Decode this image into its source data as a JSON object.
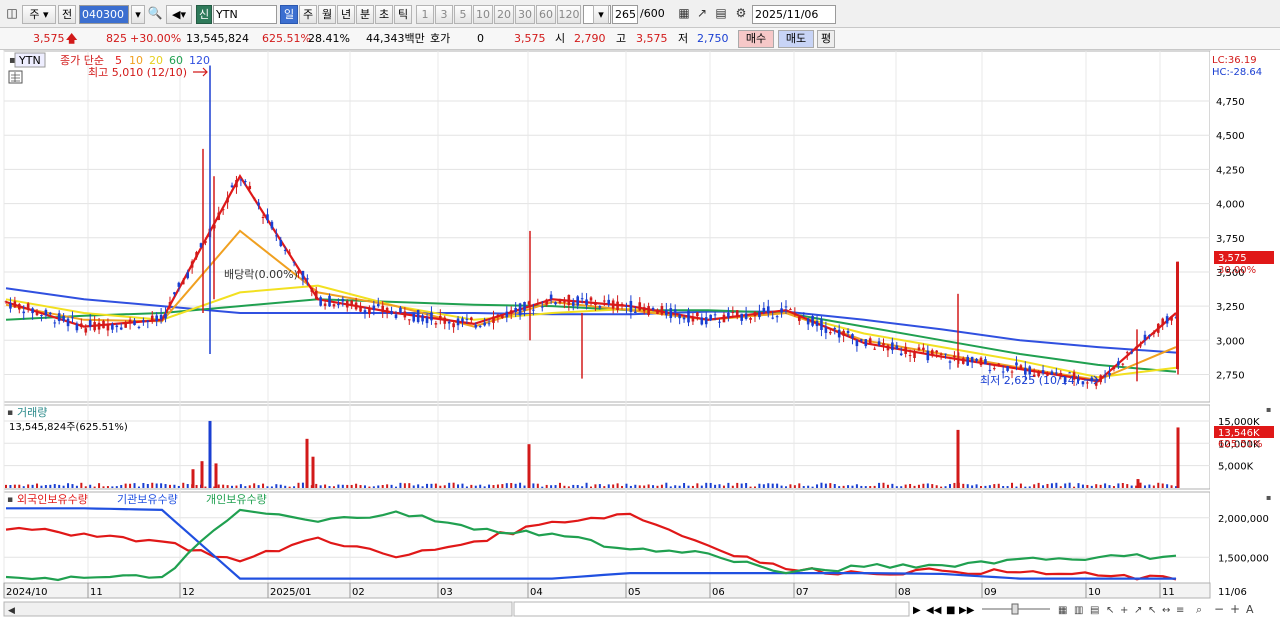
{
  "toolbar": {
    "period_label": "주",
    "prev_label": "전",
    "stock_code": "040300",
    "stock_badge": "신",
    "stock_name": "YTN",
    "period_tabs": [
      "일",
      "주",
      "월",
      "년",
      "분",
      "초",
      "틱"
    ],
    "interval_tabs": [
      "1",
      "3",
      "5",
      "10",
      "20",
      "30",
      "60",
      "120"
    ],
    "count": "265",
    "count_total": "/600",
    "date": "2025/11/06"
  },
  "quote": {
    "price": "3,575",
    "change": "825",
    "change_pct": "+30.00%",
    "volume": "13,545,824",
    "volume_pct": "625.51%",
    "turnover": "28.41%",
    "amount": "44,343백만",
    "hoga_label": "호가",
    "hoga_value": "0",
    "hoga_price": "3,575",
    "open_label": "시",
    "open": "2,790",
    "high_label": "고",
    "high": "3,575",
    "low_label": "저",
    "low": "2,750",
    "buy_label": "매수",
    "sell_label": "매도",
    "eval_label": "평"
  },
  "price_pane": {
    "symbol": "YTN",
    "legend_prefix": "종가 단순",
    "ma_periods": [
      "5",
      "10",
      "20",
      "60",
      "120"
    ],
    "high_annotation": "최고 5,010 (12/10)",
    "low_annotation": "최저 2,625 (10/14)",
    "dividend_annotation": "배당락(0.00%)",
    "lc": "LC:36.19",
    "hc": "HC:-28.64",
    "last_price_tag": "3,575",
    "last_pct_tag": "30.00%",
    "y_ticks": [
      "4,750",
      "4,500",
      "4,250",
      "4,000",
      "3,750",
      "3,500",
      "3,250",
      "3,000",
      "2,750"
    ]
  },
  "volume_pane": {
    "title": "거래량",
    "subtitle": "13,545,824주(625.51%)",
    "y_ticks": [
      "15,000K",
      "10,000K",
      "5,000K"
    ],
    "last_tag": "13,546K",
    "last_pct_tag": "625.51%"
  },
  "holdings_pane": {
    "legend": [
      "외국인보유수량",
      "기관보유수량",
      "개인보유수량"
    ],
    "y_ticks": [
      "2,000,000",
      "1,500,000"
    ]
  },
  "x_axis": {
    "labels": [
      "2024/10",
      "11",
      "12",
      "2025/01",
      "02",
      "03",
      "04",
      "05",
      "06",
      "07",
      "08",
      "09",
      "10",
      "11",
      "11/06"
    ]
  },
  "colors": {
    "up": "#d21a1a",
    "down": "#1a3fd2",
    "ma5": "#e01818",
    "ma10": "#f0a020",
    "ma20": "#f2e020",
    "ma60": "#20a050",
    "ma120": "#3050e0",
    "foreign": "#e01818",
    "institution": "#2050e0",
    "individual": "#20a050"
  },
  "chart_data": [
    {
      "type": "candlestick",
      "x_range": [
        "2024/10",
        "2025/11/06"
      ],
      "ylim": [
        2600,
        5050
      ],
      "high": {
        "value": 5010,
        "date": "12/10"
      },
      "low": {
        "value": 2625,
        "date": "10/14"
      },
      "last": {
        "open": 2790,
        "high": 3575,
        "low": 2750,
        "close": 3575
      },
      "series": [
        {
          "name": "5",
          "values": [
            3280,
            3100,
            3150,
            4200,
            3300,
            3200,
            3120,
            3300,
            3250,
            3150,
            3220,
            2980,
            2880,
            2790,
            2700,
            3200
          ]
        },
        {
          "name": "10",
          "values": [
            3260,
            3150,
            3140,
            3800,
            3350,
            3250,
            3100,
            3280,
            3220,
            3150,
            3200,
            3000,
            2900,
            2800,
            2710,
            2950
          ]
        },
        {
          "name": "20",
          "values": [
            3300,
            3200,
            3150,
            3350,
            3400,
            3250,
            3150,
            3200,
            3230,
            3150,
            3200,
            3050,
            2950,
            2850,
            2730,
            2800
          ]
        },
        {
          "name": "60",
          "values": [
            3150,
            3180,
            3200,
            3250,
            3300,
            3280,
            3260,
            3250,
            3220,
            3220,
            3200,
            3100,
            3000,
            2900,
            2820,
            2770
          ]
        },
        {
          "name": "120",
          "values": [
            3380,
            3300,
            3250,
            3200,
            3200,
            3200,
            3200,
            3190,
            3190,
            3210,
            3210,
            3150,
            3080,
            3000,
            2950,
            2910
          ]
        }
      ]
    },
    {
      "type": "bar",
      "name": "거래량",
      "ylim": [
        0,
        17000
      ],
      "last": 13546
    },
    {
      "type": "line",
      "name": "보유수량",
      "ylim": [
        1200000,
        2200000
      ],
      "series": [
        {
          "name": "외국인보유수량",
          "values": [
            1850000,
            1800000,
            1700000,
            1450000,
            1750000,
            1500000,
            1700000,
            1950000,
            2050000,
            1650000,
            1350000,
            1300000,
            1330000,
            1310000,
            1270000,
            1220000
          ]
        },
        {
          "name": "기관보유수량",
          "values": [
            2120000,
            2120000,
            2100000,
            1230000,
            1230000,
            1230000,
            1230000,
            1230000,
            1300000,
            1300000,
            1300000,
            1300000,
            1290000,
            1230000,
            1230000,
            1230000
          ]
        },
        {
          "name": "개인보유수량",
          "values": [
            1250000,
            1240000,
            1250000,
            2100000,
            1950000,
            2080000,
            1850000,
            1800000,
            1600000,
            1550000,
            1300000,
            1380000,
            1400000,
            1480000,
            1500000,
            1520000
          ]
        }
      ]
    }
  ]
}
